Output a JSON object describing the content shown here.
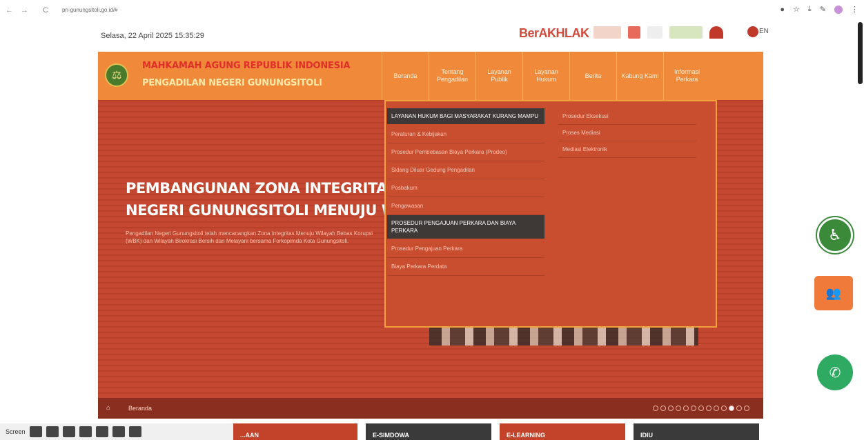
{
  "browser": {
    "url": "pn-gunungsitoli.go.id/#",
    "back": "←",
    "forward": "→",
    "reload": "C"
  },
  "top": {
    "datetime": "Selasa, 22 April 2025  15:35:29",
    "berakhlak": "BerAKHLAK",
    "lang": "EN"
  },
  "header": {
    "court_name": "MAHKAMAH AGUNG REPUBLIK INDONESIA",
    "court_sub": "PENGADILAN NEGERI GUNUNGSITOLI",
    "menu": [
      "Beranda",
      "Tentang Pengadilan",
      "Layanan Publik",
      "Layanan Hukum",
      "Berita",
      "Kabung Kami",
      "Informasi Perkara"
    ]
  },
  "hero": {
    "title_line1": "PEMBANGUNAN ZONA INTEGRITAS PENGADILAN",
    "title_line2": "NEGERI GUNUNGSITOLI MENUJU WBK DAN WBBM",
    "text": "Pengadilan Negeri Gunungsitoli telah mencanangkan Zona Integritas Menuju Wilayah Bebas Korupsi (WBK) dan Wilayah Birokrasi Bersih dan Melayani bersama Forkopimda Kota Gunungsitoli.",
    "breadcrumb": "Beranda"
  },
  "dropdown": {
    "col1": [
      {
        "type": "head",
        "label": "LAYANAN HUKUM BAGI MASYARAKAT KURANG MAMPU"
      },
      {
        "type": "item",
        "label": "Peraturan & Kebijakan"
      },
      {
        "type": "item",
        "label": "Prosedur Pembebasan Biaya Perkara (Prodeo)"
      },
      {
        "type": "item",
        "label": "Sidang Diluar Gedung Pengadilan"
      },
      {
        "type": "item",
        "label": "Posbakum"
      },
      {
        "type": "item",
        "label": "Pengawasan"
      },
      {
        "type": "head",
        "label": "PROSEDUR PENGAJUAN PERKARA DAN BIAYA PERKARA"
      },
      {
        "type": "item",
        "label": "Prosedur Pengajuan Perkara"
      },
      {
        "type": "item",
        "label": "Biaya Perkara Perdata"
      }
    ],
    "col2": [
      "Prosedur Eksekusi",
      "Proses Mediasi",
      "Mediasi Elektronik"
    ]
  },
  "bottom_cards": [
    {
      "label": "...AAN",
      "color": "#c2422a"
    },
    {
      "label": "E-SIMDOWA",
      "color": "#3a3a3a"
    },
    {
      "label": "E-LEARNING",
      "color": "#c2422a"
    },
    {
      "label": "IDIU",
      "color": "#3a3a3a"
    }
  ],
  "taskbar": {
    "label": "Screen"
  },
  "colors": {
    "header_orange": "#f0893a",
    "hero_red": "#c2422a",
    "dropdown_head": "#3e3836",
    "whatsapp": "#2eaa62"
  }
}
